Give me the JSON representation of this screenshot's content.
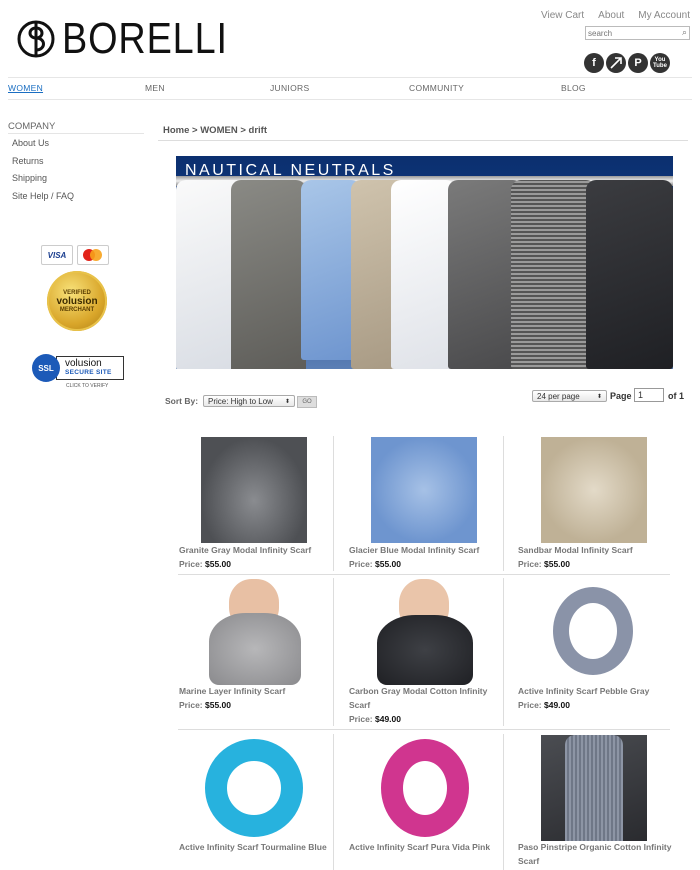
{
  "brand": {
    "name": "BORELLI"
  },
  "toplinks": [
    "View Cart",
    "About",
    "My Account"
  ],
  "search": {
    "placeholder": "search"
  },
  "social": [
    "f",
    "share",
    "P",
    "You Tube"
  ],
  "nav": [
    "WOMEN",
    "MEN",
    "JUNIORS",
    "COMMUNITY",
    "BLOG"
  ],
  "sidebar": {
    "title": "COMPANY",
    "links": [
      "About Us",
      "Returns",
      "Shipping",
      "Site Help / FAQ"
    ],
    "badges": {
      "visa": "VISA",
      "seal_top": "VERIFIED",
      "seal_mid": "volusion",
      "seal_bottom": "MERCHANT",
      "ssl": "SSL",
      "ssl_brand": "volusion",
      "ssl_sub": "SECURE SITE",
      "ssl_caption": "CLICK TO VERIFY"
    }
  },
  "breadcrumb": "Home > WOMEN > drift",
  "banner": {
    "title": "NAUTICAL NEUTRALS"
  },
  "toolbar": {
    "sort_label": "Sort By:",
    "sort_value": "Price: High to Low",
    "go": "GO",
    "per_page": "24 per page",
    "page_label": "Page",
    "page_value": "1",
    "page_of": "of 1"
  },
  "products": [
    {
      "name": "Granite Gray Modal Infinity Scarf",
      "price_label": "Price:",
      "price": "$55.00",
      "color": "#5d5f63"
    },
    {
      "name": "Glacier Blue Modal Infinity Scarf",
      "price_label": "Price:",
      "price": "$55.00",
      "color": "#6e95cf"
    },
    {
      "name": "Sandbar Modal Infinity Scarf",
      "price_label": "Price:",
      "price": "$55.00",
      "color": "#cfc3ad"
    },
    {
      "name": "Marine Layer Infinity Scarf",
      "price_label": "Price:",
      "price": "$55.00",
      "color": "#9a9a9c"
    },
    {
      "name": "Carbon Gray Modal Cotton Infinity Scarf",
      "price_label": "Price:",
      "price": "$49.00",
      "color": "#2a2c30"
    },
    {
      "name": "Active Infinity Scarf Pebble Gray",
      "price_label": "Price:",
      "price": "$49.00",
      "color": "#8a93a8"
    },
    {
      "name": "Active Infinity Scarf Tourmaline Blue",
      "price_label": "",
      "price": "",
      "color": "#27b2de"
    },
    {
      "name": "Active Infinity Scarf Pura Vida Pink",
      "price_label": "",
      "price": "",
      "color": "#d0358f"
    },
    {
      "name": "Paso Pinstripe Organic Cotton Infinity Scarf",
      "price_label": "",
      "price": "",
      "color": "#7d8596"
    }
  ]
}
